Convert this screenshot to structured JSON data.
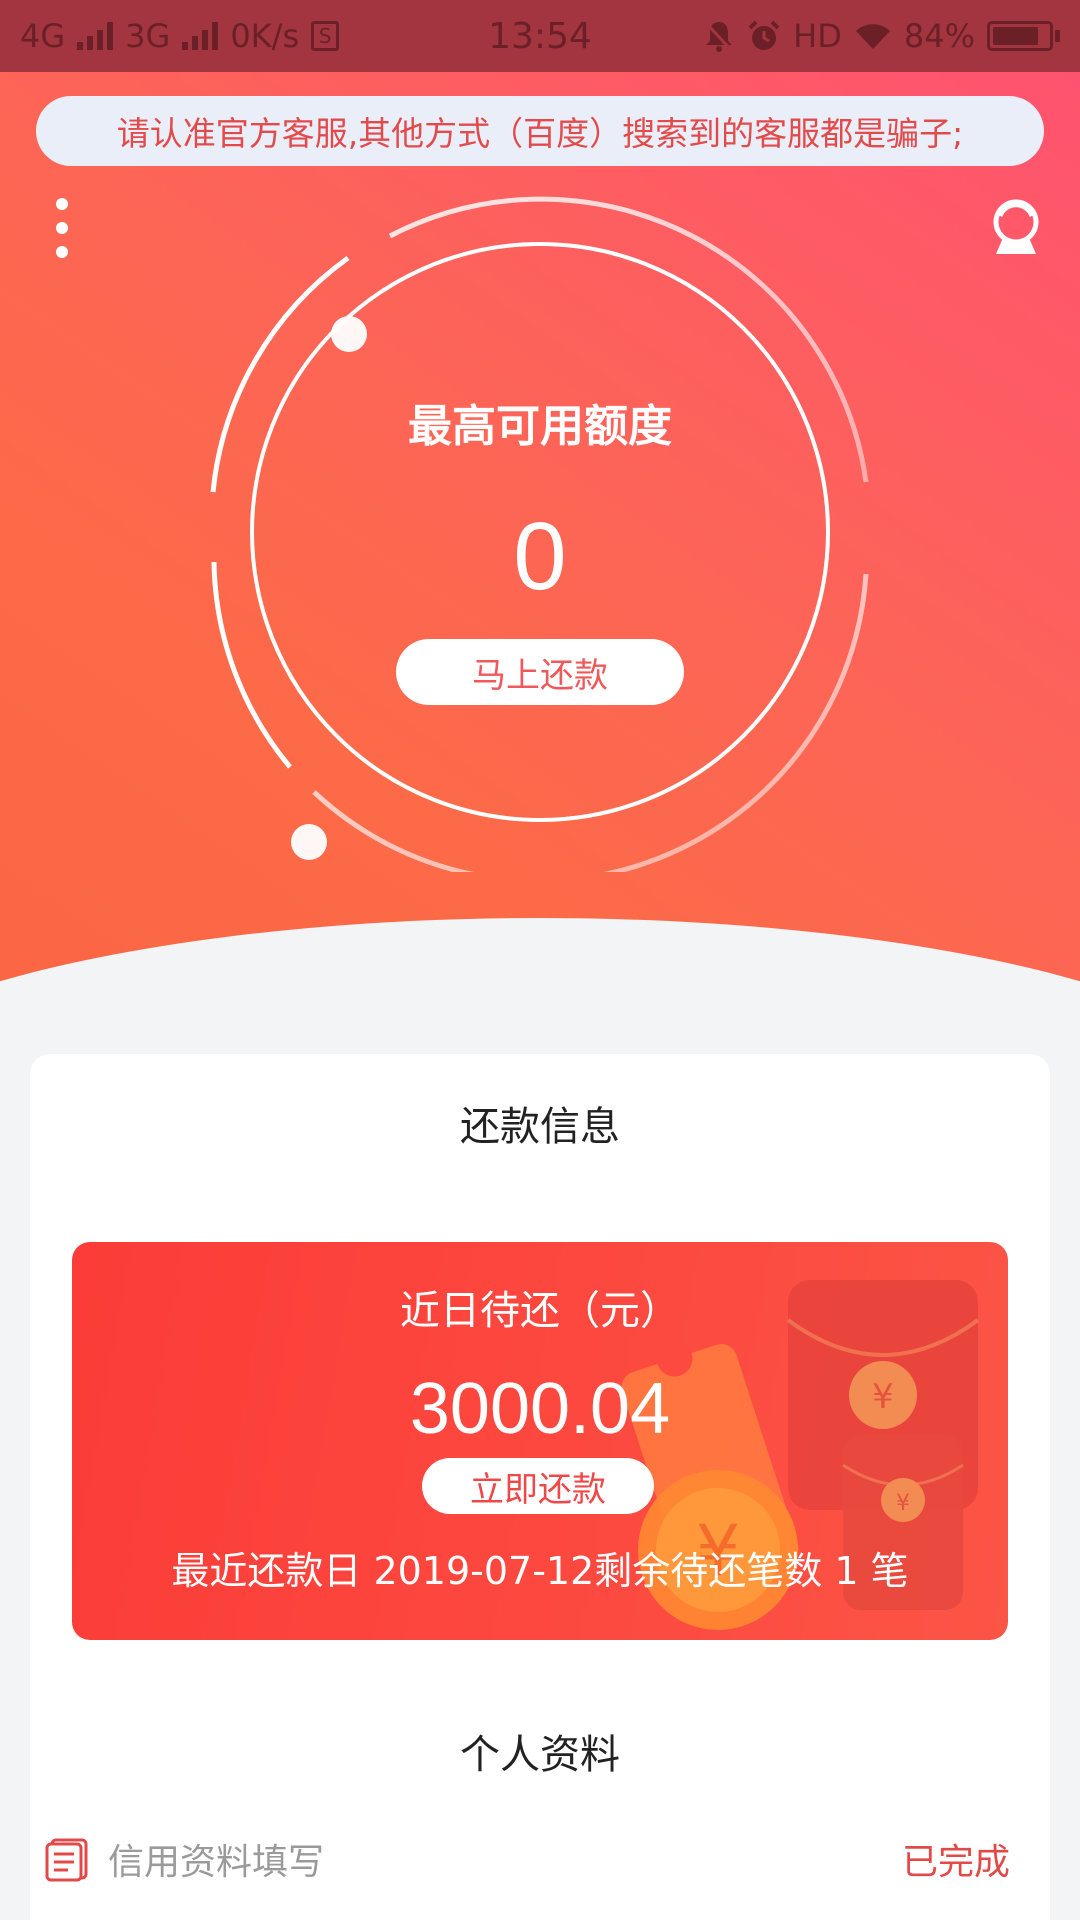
{
  "status_bar": {
    "net1": "4G",
    "net2": "3G",
    "speed": "0K/s",
    "sim": "S",
    "time": "13:54",
    "hd": "HD",
    "battery": "84%",
    "battery_level": 0.84
  },
  "hero": {
    "notice": "请认准官方客服,其他方式（百度）搜索到的客服都是骗子;",
    "credit_label": "最高可用额度",
    "credit_value": "0",
    "repay_button": "马上还款"
  },
  "repayment": {
    "section_title": "还款信息",
    "pending_label": "近日待还（元）",
    "pending_amount": "3000.04",
    "pay_now_button": "立即还款",
    "meta": "最近还款日 2019-07-12剩余待还笔数 1 笔"
  },
  "profile": {
    "section_title": "个人资料",
    "item_label": "信用资料填写",
    "item_status": "已完成"
  },
  "colors": {
    "accent": "#f0595a",
    "banner": "#fb3c38",
    "status_bar": "#a2353f"
  },
  "icons": {
    "menu": "more-vertical-icon",
    "service": "customer-service-icon",
    "doc": "document-icon"
  }
}
